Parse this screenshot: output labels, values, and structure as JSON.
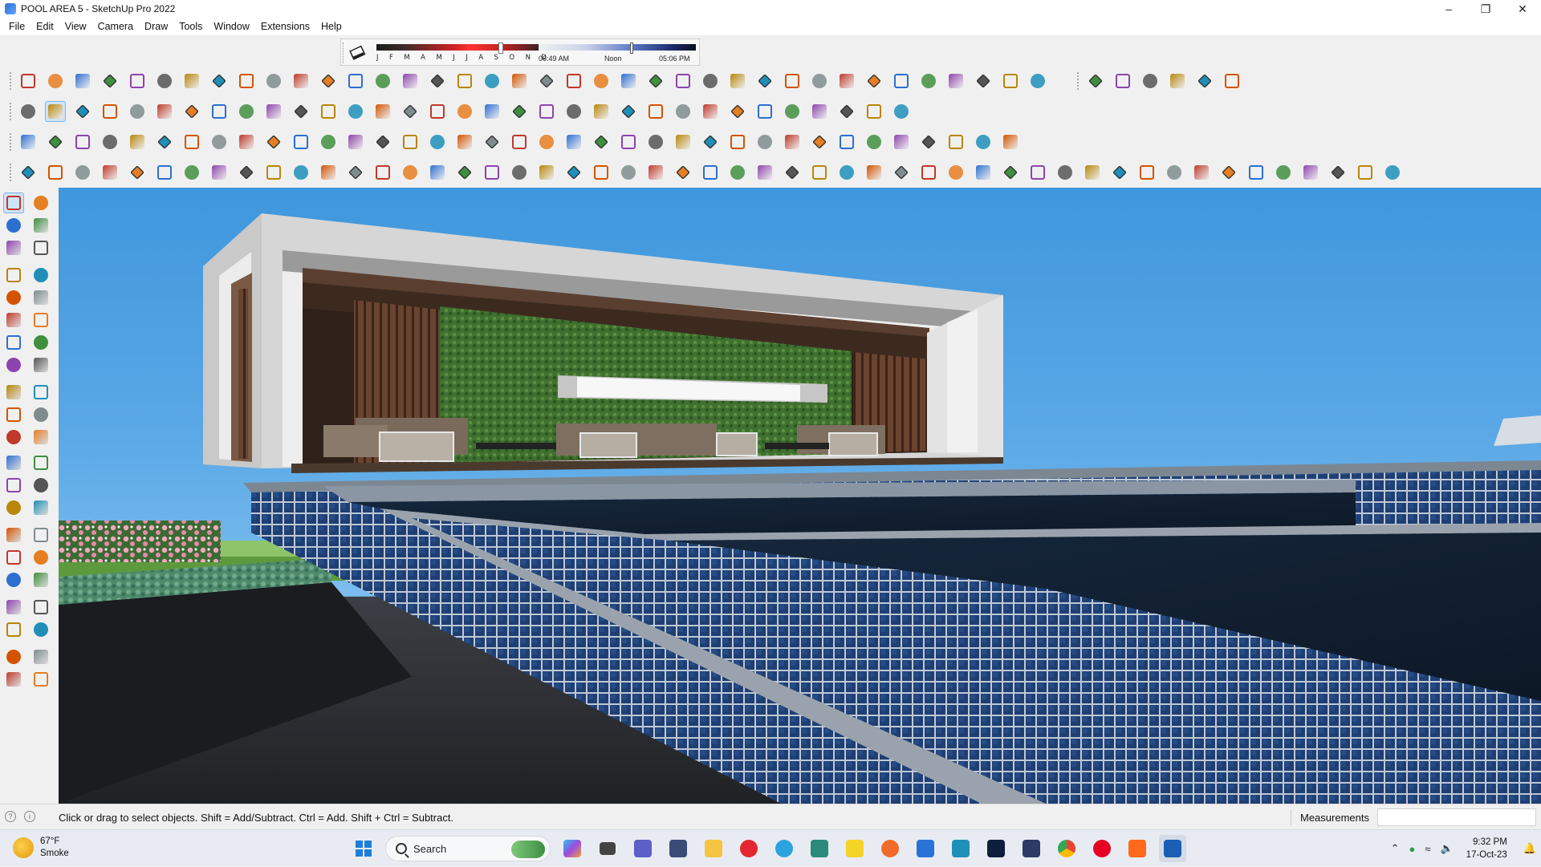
{
  "window": {
    "title": "POOL AREA 5 - SketchUp Pro 2022",
    "controls": {
      "minimize": "–",
      "maximize": "❐",
      "close": "✕"
    }
  },
  "menu": [
    "File",
    "Edit",
    "View",
    "Camera",
    "Draw",
    "Tools",
    "Window",
    "Extensions",
    "Help"
  ],
  "shadows": {
    "months": [
      "J",
      "F",
      "M",
      "A",
      "M",
      "J",
      "J",
      "A",
      "S",
      "O",
      "N",
      "D"
    ],
    "time_start": "06:49 AM",
    "time_mid": "Noon",
    "time_end": "05:06 PM"
  },
  "status": {
    "message": "Click or drag to select objects. Shift = Add/Subtract. Ctrl = Add. Shift + Ctrl = Subtract.",
    "measurements_label": "Measurements",
    "measurements_value": ""
  },
  "taskbar": {
    "weather_temp": "67°F",
    "weather_desc": "Smoke",
    "search_label": "Search",
    "time": "9:32 PM",
    "date": "17-Oct-23"
  },
  "colors": {
    "accent": "#2c6fd1",
    "sky_top": "#3f97dc",
    "wall_stone": "#d8d8d8",
    "wood": "#5a3a2a",
    "green_wall": "#3d6b2a",
    "pool_tile": "#1f3a66"
  }
}
